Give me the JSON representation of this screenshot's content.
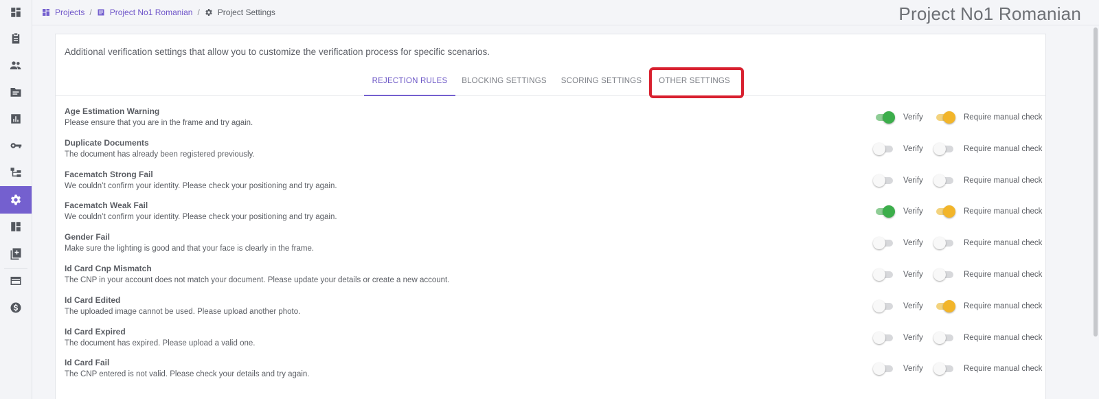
{
  "sidebar": {
    "items": [
      {
        "icon": "dashboard-icon",
        "top": 0
      },
      {
        "icon": "clipboard-icon",
        "top": 0
      },
      {
        "icon": "users-icon",
        "top": 0
      },
      {
        "icon": "folder-icon",
        "top": 0
      },
      {
        "icon": "bar-chart-icon",
        "top": 0
      },
      {
        "icon": "key-icon",
        "top": 0
      },
      {
        "icon": "workflow-icon",
        "top": 0
      },
      {
        "icon": "settings-icon",
        "top": 0,
        "active": true
      },
      {
        "icon": "layout-icon",
        "top": 0
      },
      {
        "icon": "add-document-icon",
        "top": 0
      },
      {
        "icon": "credit-card-icon",
        "top": 0
      },
      {
        "icon": "dollar-icon",
        "top": 0
      }
    ]
  },
  "breadcrumb": {
    "projects": "Projects",
    "project": "Project No1 Romanian",
    "current": "Project Settings",
    "separator": "/"
  },
  "page_title": "Project No1 Romanian",
  "card": {
    "description": "Additional verification settings that allow you to customize the verification process for specific scenarios."
  },
  "tabs": [
    {
      "label": "REJECTION RULES",
      "active": true
    },
    {
      "label": "BLOCKING SETTINGS",
      "active": false
    },
    {
      "label": "SCORING SETTINGS",
      "active": false
    },
    {
      "label": "OTHER SETTINGS",
      "active": false,
      "highlighted": true
    }
  ],
  "labels": {
    "verify": "Verify",
    "manual": "Require manual check"
  },
  "rules": [
    {
      "title": "Age Estimation Warning",
      "text": "Please ensure that you are in the frame and try again.",
      "verify": true,
      "manual": true
    },
    {
      "title": "Duplicate Documents",
      "text": "The document has already been registered previously.",
      "verify": false,
      "manual": false
    },
    {
      "title": "Facematch Strong Fail",
      "text": "We couldn’t confirm your identity. Please check your positioning and try again.",
      "verify": false,
      "manual": false
    },
    {
      "title": "Facematch Weak Fail",
      "text": "We couldn’t confirm your identity. Please check your positioning and try again.",
      "verify": true,
      "manual": true
    },
    {
      "title": "Gender Fail",
      "text": "Make sure the lighting is good and that your face is clearly in the frame.",
      "verify": false,
      "manual": false
    },
    {
      "title": "Id Card Cnp Mismatch",
      "text": "The CNP in your account does not match your document. Please update your details or create a new account.",
      "verify": false,
      "manual": false
    },
    {
      "title": "Id Card Edited",
      "text": "The uploaded image cannot be used. Please upload another photo.",
      "verify": false,
      "manual": true
    },
    {
      "title": "Id Card Expired",
      "text": "The document has expired. Please upload a valid one.",
      "verify": false,
      "manual": false
    },
    {
      "title": "Id Card Fail",
      "text": "The CNP entered is not valid. Please check your details and try again.",
      "verify": false,
      "manual": false
    }
  ],
  "colors": {
    "accent": "#7460cf",
    "verify_on": "#3cae4b",
    "manual_on": "#f2b52a",
    "highlight": "#d8202f"
  }
}
